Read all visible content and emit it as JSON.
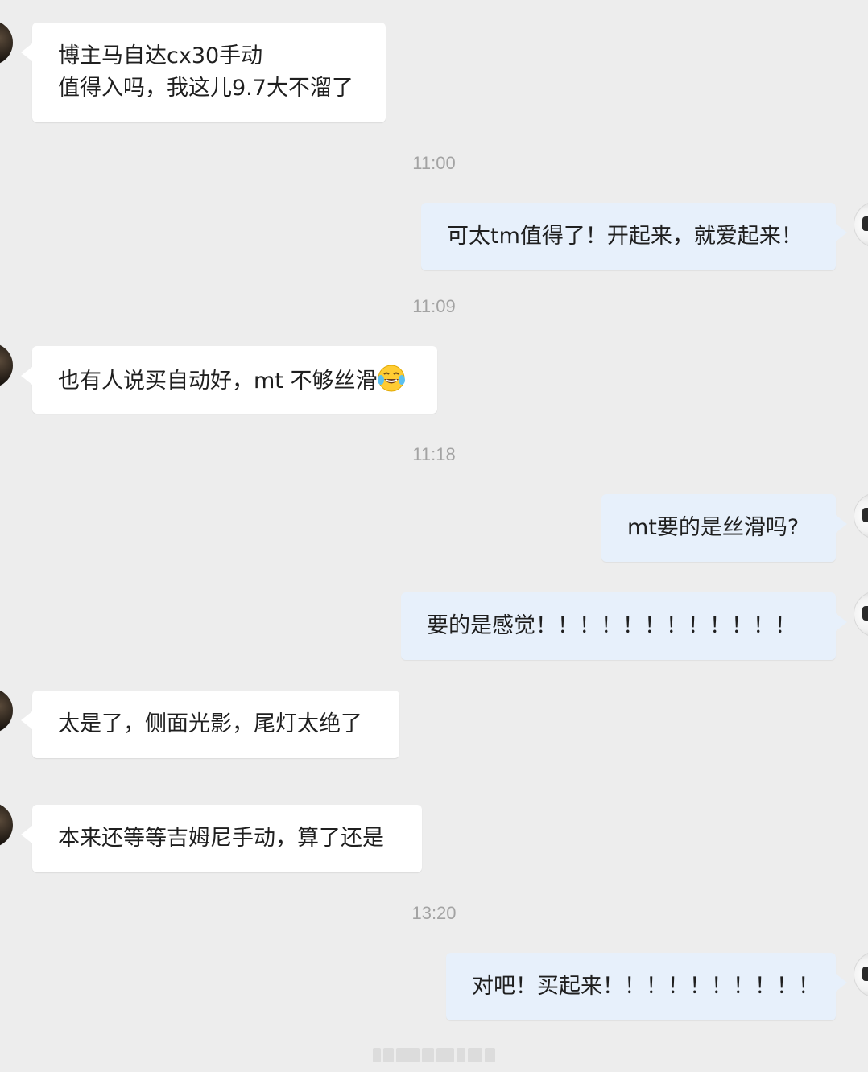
{
  "messages": [
    {
      "side": "in",
      "lines": [
        "博主马自达cx30手动",
        "值得入吗，我这儿9.7大不溜了"
      ]
    },
    {
      "side": "out",
      "text": "可太tm值得了！开起来，就爱起来！"
    },
    {
      "side": "in",
      "text": "也有人说买自动好，mt 不够丝滑",
      "emoji": "laughing-with-tears-emoji"
    },
    {
      "side": "out",
      "text": "mt要的是丝滑吗?"
    },
    {
      "side": "out",
      "text": "要的是感觉！！！！！！！！！！！！"
    },
    {
      "side": "in",
      "text": "太是了，侧面光影，尾灯太绝了"
    },
    {
      "side": "in",
      "text": "本来还等等吉姆尼手动，算了还是"
    },
    {
      "side": "out",
      "text": "对吧！买起来！！！！！！！！！！"
    }
  ],
  "timestamps": [
    "11:00",
    "11:09",
    "11:18",
    "13:20"
  ],
  "colors": {
    "background": "#ededed",
    "incoming_bubble": "#ffffff",
    "outgoing_bubble": "#e7f0fb",
    "timestamp_text": "#a3a3a3"
  }
}
